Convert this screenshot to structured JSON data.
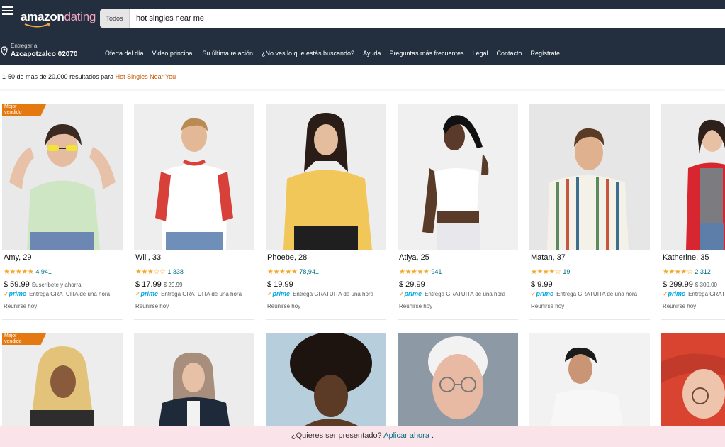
{
  "header": {
    "logo_bold": "amazon",
    "logo_light": "dating",
    "search_category": "Todos",
    "search_value": "hot singles near me",
    "menu_icon": "hamburger-menu-icon",
    "logo_smile_color": "#f3a847"
  },
  "nav": {
    "deliver_label": "Entregar a",
    "deliver_location": "Azcapotzalco 02070",
    "location_icon": "location-pin-icon",
    "links": [
      "Oferta del día",
      "Video principal",
      "Su última relación",
      "¿No ves lo que estás buscando?",
      "Ayuda",
      "Preguntas más frecuentes",
      "Legal",
      "Contacto",
      "Regístrate"
    ]
  },
  "results": {
    "summary_prefix": "1-50 de más de 20,000 resultados para ",
    "query": "Hot Singles Near You"
  },
  "labels": {
    "bestseller": "Mejor vendido",
    "prime": "prime",
    "prime_delivery": "Entrega GRATUITA de una hora",
    "meet": "Reunirse hoy"
  },
  "profiles": [
    {
      "name": "Amy, 29",
      "stars": 4.5,
      "star_text": "★★★★★",
      "reviews": "4,941",
      "price": "$ 59.99",
      "price_note": "Suscríbete y ahorra!",
      "old_price": "",
      "bestseller": true
    },
    {
      "name": "Will, 33",
      "stars": 3,
      "star_text": "★★★☆☆",
      "reviews": "1,338",
      "price": "$ 17.99",
      "price_note": "",
      "old_price": "$ 29.99",
      "bestseller": false
    },
    {
      "name": "Phoebe, 28",
      "stars": 4.5,
      "star_text": "★★★★★",
      "reviews": "78,941",
      "price": "$ 19.99",
      "price_note": "",
      "old_price": "",
      "bestseller": false
    },
    {
      "name": "Atiya, 25",
      "stars": 4.5,
      "star_text": "★★★★★",
      "reviews": "941",
      "price": "$ 29.99",
      "price_note": "",
      "old_price": "",
      "bestseller": false
    },
    {
      "name": "Matan, 37",
      "stars": 4,
      "star_text": "★★★★☆",
      "reviews": "19",
      "price": "$ 9.99",
      "price_note": "",
      "old_price": "",
      "bestseller": false
    },
    {
      "name": "Katherine, 35",
      "stars": 3.5,
      "star_text": "★★★★☆",
      "reviews": "2,312",
      "price": "$ 299.99",
      "price_note": "",
      "old_price": "$ 300.00",
      "bestseller": false
    }
  ],
  "second_row_bestseller": true,
  "banner": {
    "text": "¿Quieres ser presentado? ",
    "link": "Aplicar ahora",
    "suffix": " ."
  },
  "colors": {
    "header_bg": "#232f3e",
    "badge": "#e47911",
    "star": "#f5a623",
    "link": "#007185",
    "query": "#c45500",
    "banner_bg": "#fbe3ea"
  }
}
